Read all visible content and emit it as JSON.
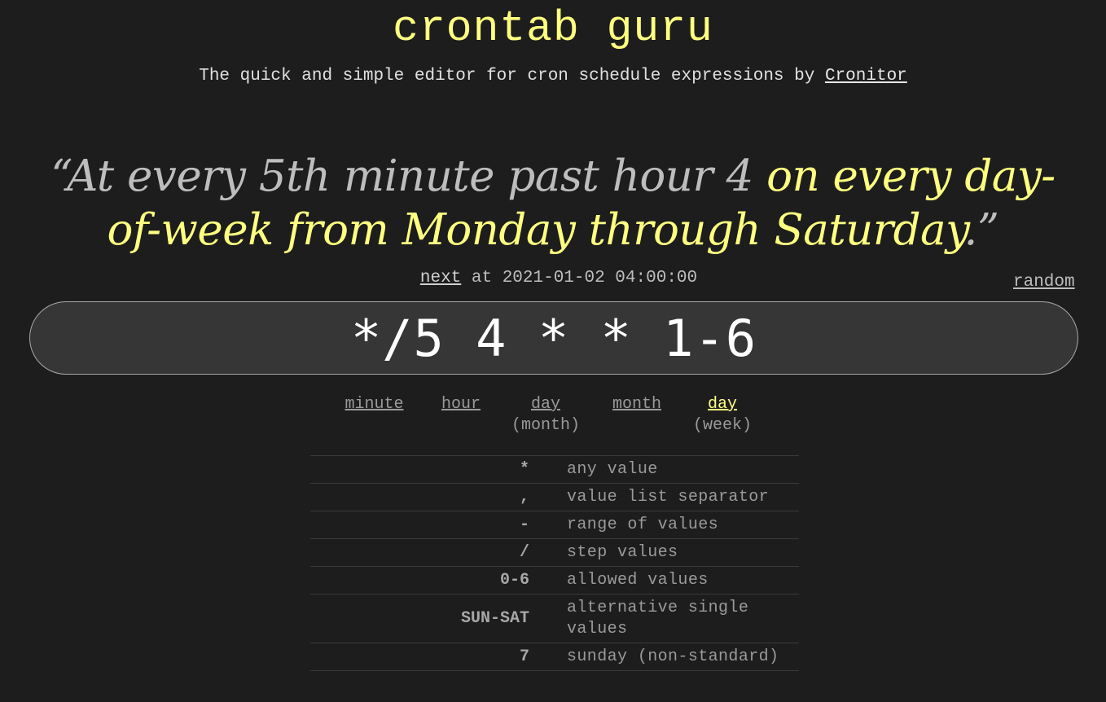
{
  "header": {
    "title": "crontab guru",
    "subtitle_prefix": "The quick and simple editor for cron schedule expressions by ",
    "subtitle_link": "Cronitor"
  },
  "description": {
    "open_quote": "“",
    "plain": "At every 5th minute past hour 4 ",
    "highlighted": "on every day-of-week from Monday through Saturday",
    "close": ".”"
  },
  "next_run": {
    "link": "next",
    "text": " at 2021-01-02 04:00:00"
  },
  "random_link": "random",
  "expression": "*/5 4 * * 1-6",
  "fields": [
    {
      "label": "minute",
      "sub": ""
    },
    {
      "label": "hour",
      "sub": ""
    },
    {
      "label": "day",
      "sub": "(month)"
    },
    {
      "label": "month",
      "sub": ""
    },
    {
      "label": "day",
      "sub": "(week)",
      "active": true
    }
  ],
  "legend": [
    {
      "symbol": "*",
      "text": "any value"
    },
    {
      "symbol": ",",
      "text": "value list separator"
    },
    {
      "symbol": "-",
      "text": "range of values"
    },
    {
      "symbol": "/",
      "text": "step values"
    },
    {
      "symbol": "0-6",
      "text": "allowed values"
    },
    {
      "symbol": "SUN-SAT",
      "text_line1": "alternative single",
      "text_line2": "values"
    },
    {
      "symbol": "7",
      "text": "sunday (non-standard)"
    }
  ],
  "colors": {
    "background": "#1d1d1d",
    "accent": "#ffff80",
    "input_bg": "#363636"
  }
}
